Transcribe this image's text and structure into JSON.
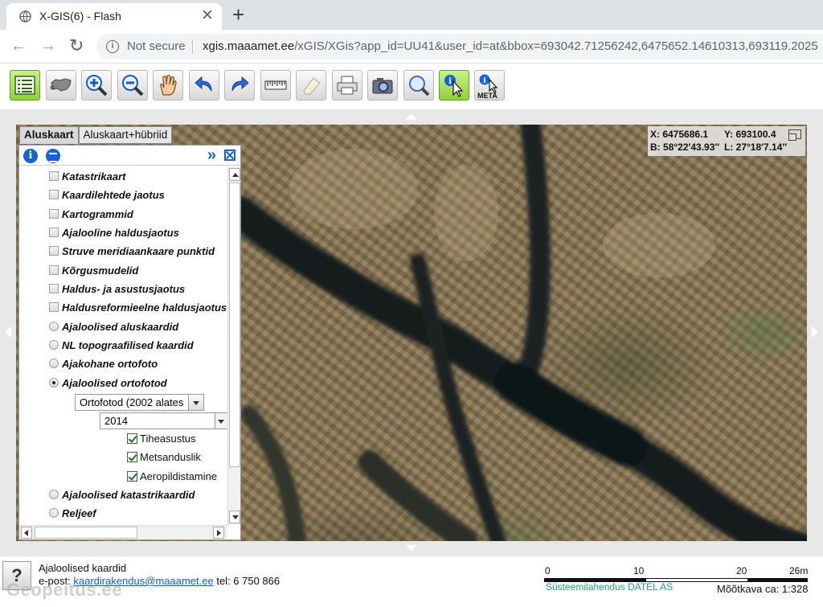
{
  "browser": {
    "tab_title": "X-GIS(6) - Flash",
    "security_label": "Not secure",
    "url_host": "xgis.maaamet.ee",
    "url_path": "/xGIS/XGis?app_id=UU41&user_id=at&bbox=693042.71256242,6475652.14610313,693119.2025"
  },
  "toolbar": {
    "buttons": [
      "layers-list",
      "estonia-map",
      "zoom-in",
      "zoom-out",
      "pan-hand",
      "undo",
      "redo",
      "ruler",
      "eraser",
      "print",
      "camera",
      "search-zoom",
      "info-pointer",
      "meta-info"
    ],
    "meta_label": "META",
    "active_color": "#8fd13c"
  },
  "layer_tabs": [
    "Aluskaart",
    "Aluskaart+hübriid"
  ],
  "layers": [
    {
      "label": "Katastrikaart",
      "type": "checkbox",
      "checked": false
    },
    {
      "label": "Kaardilehtede jaotus",
      "type": "checkbox",
      "checked": false
    },
    {
      "label": "Kartogrammid",
      "type": "checkbox",
      "checked": false
    },
    {
      "label": "Ajalooline haldusjaotus",
      "type": "checkbox",
      "checked": false
    },
    {
      "label": "Struve meridiaankaare punktid",
      "type": "checkbox",
      "checked": false
    },
    {
      "label": "Kõrgusmudelid",
      "type": "checkbox",
      "checked": false
    },
    {
      "label": "Haldus- ja asustusjaotus",
      "type": "checkbox",
      "checked": false
    },
    {
      "label": "Haldusreformieelne haldusjaotus",
      "type": "checkbox",
      "checked": false
    },
    {
      "label": "Ajaloolised aluskaardid",
      "type": "radio",
      "checked": false
    },
    {
      "label": "NL topograafilised kaardid",
      "type": "radio",
      "checked": false
    },
    {
      "label": "Ajakohane ortofoto",
      "type": "radio",
      "checked": false
    },
    {
      "label": "Ajaloolised ortofotod",
      "type": "radio",
      "checked": true
    }
  ],
  "ortho": {
    "series_select": "Ortofotod (2002 alates",
    "year_select": "2014",
    "sublayers": [
      "Tiheasustus",
      "Metsanduslik",
      "Aeropildistamine"
    ]
  },
  "layers_after": [
    {
      "label": "Ajaloolised katastrikaardid",
      "type": "radio",
      "checked": false
    },
    {
      "label": "Reljeef",
      "type": "radio",
      "checked": false
    }
  ],
  "coords": {
    "x": "X: 6475686.1",
    "y": "Y: 693100.4",
    "b": "B: 58°22′43.93″",
    "l": "L: 27°18′7.14″"
  },
  "footer": {
    "title": "Ajaloolised kaardid",
    "email_prefix": "e-post: ",
    "email": "kaardirakendus@maaamet.ee",
    "phone": " tel: 6 750 866",
    "watermark": "Geopeitus.ee",
    "help_label": "?"
  },
  "scale": {
    "ticks": [
      "0",
      "10",
      "20",
      "26m"
    ],
    "credit": "Süsteemilahendus DATEL AS",
    "scale_text": "Mõõtkava ca: 1:328"
  }
}
